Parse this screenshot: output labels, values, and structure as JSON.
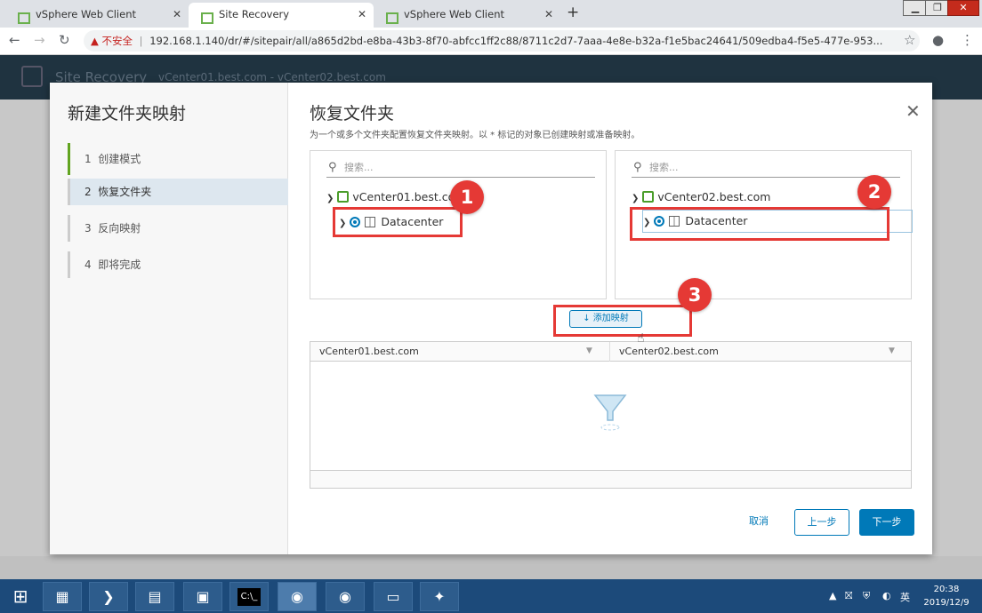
{
  "browser": {
    "tabs": [
      {
        "label": "vSphere Web Client"
      },
      {
        "label": "Site Recovery"
      },
      {
        "label": "vSphere Web Client"
      }
    ],
    "new_tab": "+",
    "security_label": "不安全",
    "url": "192.168.1.140/dr/#/sitepair/all/a865d2bd-e8ba-43b3-8f70-abfcc1ff2c88/8711c2d7-7aaa-4e8e-b32a-f1e5bac24641/509edba4-f5e5-477e-953..."
  },
  "app_header": {
    "title": "Site Recovery",
    "context": "vCenter01.best.com - vCenter02.best.com"
  },
  "wizard": {
    "title": "新建文件夹映射",
    "steps": [
      {
        "num": "1",
        "label": "创建模式"
      },
      {
        "num": "2",
        "label": "恢复文件夹"
      },
      {
        "num": "3",
        "label": "反向映射"
      },
      {
        "num": "4",
        "label": "即将完成"
      }
    ]
  },
  "page": {
    "title": "恢复文件夹",
    "description": "为一个或多个文件夹配置恢复文件夹映射。以 * 标记的对象已创建映射或准备映射。"
  },
  "left_tree": {
    "search_placeholder": "搜索...",
    "root": "vCenter01.best.com",
    "child": "Datacenter"
  },
  "right_tree": {
    "search_placeholder": "搜索...",
    "root": "vCenter02.best.com",
    "child": "Datacenter"
  },
  "add_mapping_label": "↓ 添加映射",
  "mapping_grid": {
    "columns": [
      "vCenter01.best.com",
      "vCenter02.best.com"
    ]
  },
  "buttons": {
    "cancel": "取消",
    "back": "上一步",
    "next": "下一步"
  },
  "annotations": [
    "1",
    "2",
    "3"
  ],
  "taskbar": {
    "clock_time": "20:38",
    "clock_date": "2019/12/9",
    "ime": "英"
  },
  "colors": {
    "accent": "#0079b8",
    "annotation_red": "#e53935",
    "step_done": "#62a420"
  }
}
